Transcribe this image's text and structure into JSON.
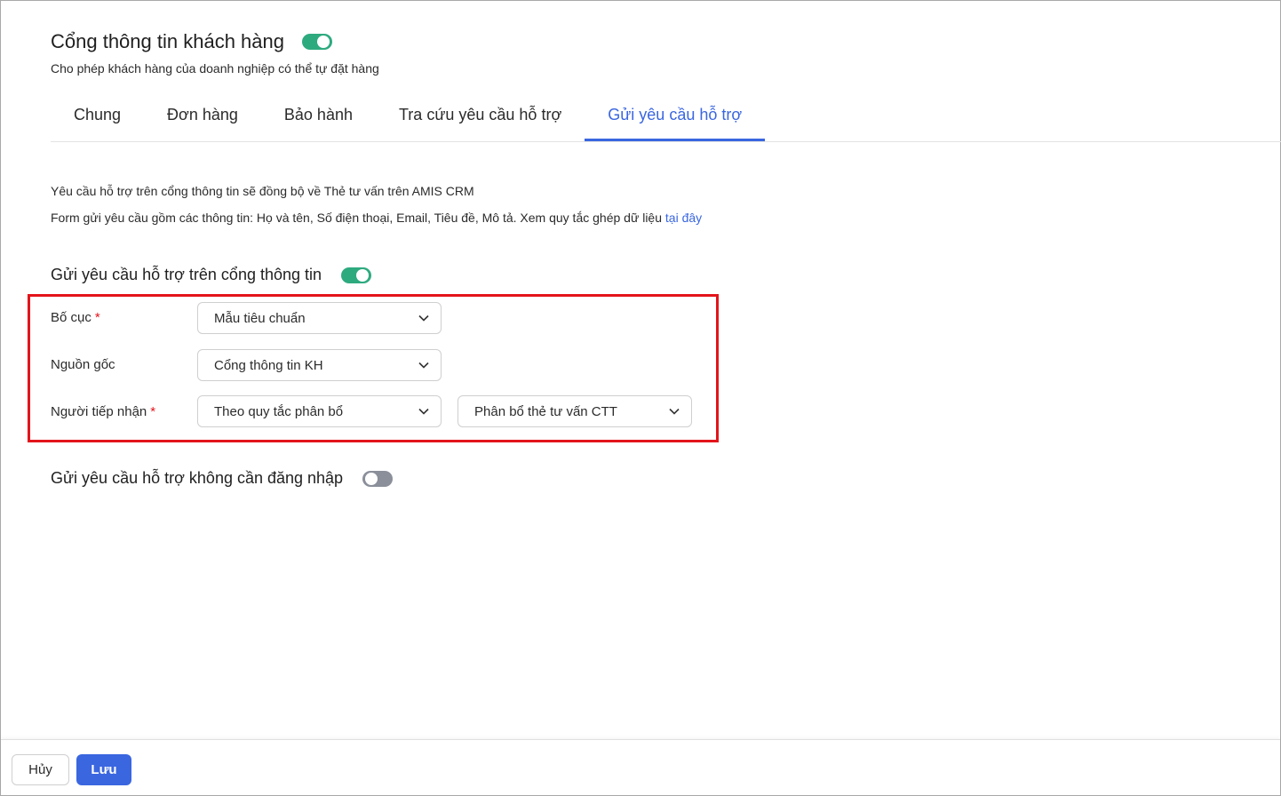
{
  "header": {
    "title": "Cổng thông tin khách hàng",
    "subtitle": "Cho phép khách hàng của doanh nghiệp có thể tự đặt hàng",
    "enabled": true
  },
  "tabs": [
    {
      "label": "Chung",
      "active": false
    },
    {
      "label": "Đơn hàng",
      "active": false
    },
    {
      "label": "Bảo hành",
      "active": false
    },
    {
      "label": "Tra cứu yêu cầu hỗ trợ",
      "active": false
    },
    {
      "label": "Gửi yêu cầu hỗ trợ",
      "active": true
    }
  ],
  "info": {
    "line1": "Yêu cầu hỗ trợ trên cổng thông tin sẽ đồng bộ về Thẻ tư vấn trên AMIS CRM",
    "line2_text": "Form gửi yêu cầu gồm các thông tin: Họ và tên, Số điện thoại, Email, Tiêu đề, Mô tả. Xem quy tắc ghép dữ liệu",
    "line2_link": "tại đây"
  },
  "section_portal": {
    "title": "Gửi yêu cầu hỗ trợ trên cổng thông tin",
    "enabled": true
  },
  "form": {
    "layout": {
      "label": "Bố cục",
      "required_mark": "*",
      "value": "Mẫu tiêu chuẩn"
    },
    "source": {
      "label": "Nguồn gốc",
      "value": "Cổng thông tin KH"
    },
    "receiver": {
      "label": "Người tiếp nhận",
      "required_mark": "*",
      "value": "Theo quy tắc phân bổ",
      "rule_value": "Phân bổ thẻ tư vấn CTT"
    }
  },
  "section_guest": {
    "title": "Gửi yêu cầu hỗ trợ không cần đăng nhập",
    "enabled": false
  },
  "footer": {
    "cancel_label": "Hủy",
    "save_label": "Lưu"
  },
  "colors": {
    "accent": "#3a66e0",
    "toggle_on": "#2eaa7f",
    "toggle_off": "#8a8f99",
    "highlight": "#e3141b"
  }
}
